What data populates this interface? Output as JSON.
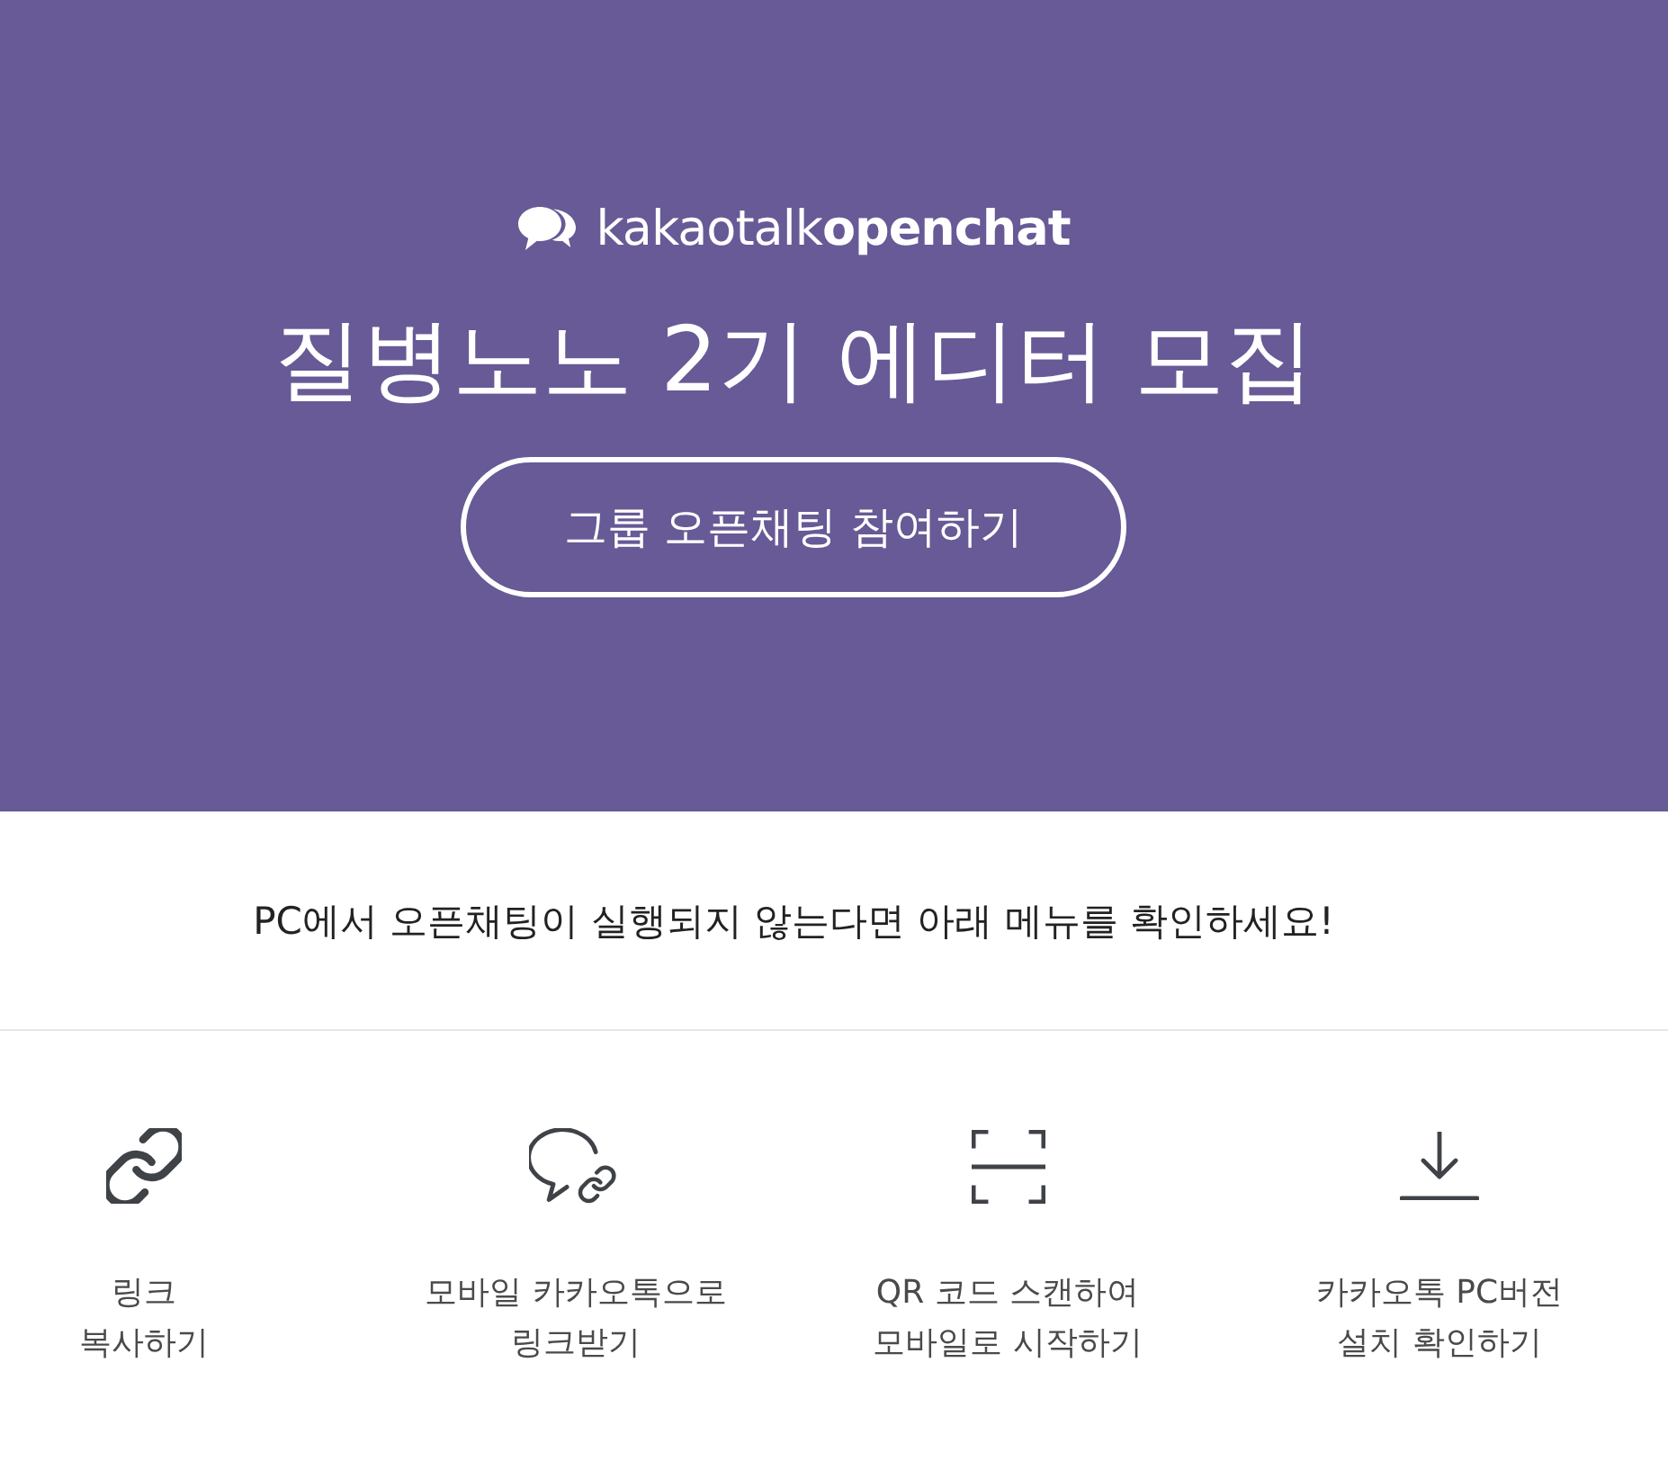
{
  "header": {
    "logo": {
      "text": "kakaotalk**openchat**"
    },
    "title": "질병노노 2기 에디터 모집",
    "join_button": {
      "label": "그룹 오픈채팅 참여하기"
    }
  },
  "notice": "PC에서 오픈채팅이 실행되지 않는다면 아래 메뉴를 확인하세요!",
  "options": [
    {
      "kind": "copy_link",
      "label": "링크\n복사하기"
    },
    {
      "kind": "send_to_mobile",
      "label": "모바일 카카오톡으로\n링크받기"
    },
    {
      "kind": "qr_scan",
      "label": "QR 코드 스캔하여\n모바일로 시작하기"
    },
    {
      "kind": "install_pc",
      "label": "카카오톡 PC버전\n설치 확인하기"
    }
  ]
}
